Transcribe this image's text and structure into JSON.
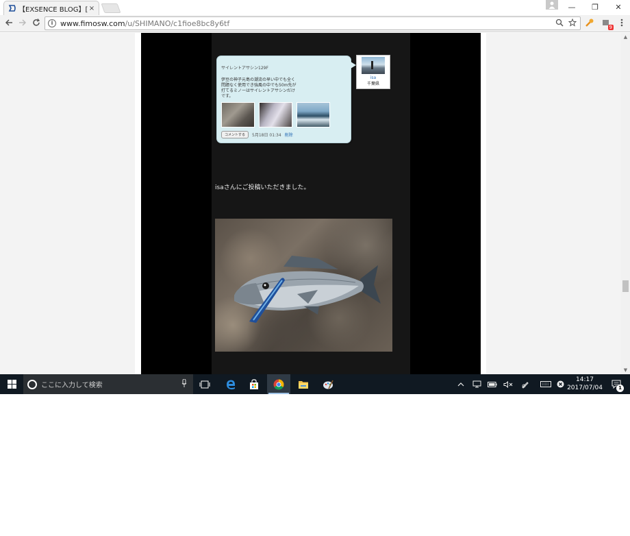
{
  "browser": {
    "tab_title": "【EXSENCE BLOG】[結果",
    "tab_close": "×",
    "url_host": "www.fimosw.com",
    "url_path": "/u/SHIMANO/c1fioe8bc8y6tf",
    "info_glyph": "i",
    "ext_badge": "9",
    "window_minimize": "—",
    "window_restore": "❐",
    "window_close": "✕"
  },
  "post": {
    "bubble_title": "サイレントアサシン129F",
    "bubble_body": "伊豆の神子元島の潮流の早い中でも全く問題なく使用でき強風の中でも50m先が打てるミノーはサイレントアサシンだけです。",
    "comment_button": "コメントする",
    "date": "5月18日 01:34",
    "delete_link": "削除",
    "user_name": "isa",
    "user_prefecture": "千葉県",
    "caption": "isaさんにご投稿いただきました。"
  },
  "taskbar": {
    "search_placeholder": "ここに入力して検索",
    "time": "14:17",
    "date": "2017/07/04",
    "notification_count": "1"
  },
  "colors": {
    "page_background": "#000000",
    "content_column": "#161616",
    "bubble_fill": "#d8eef2",
    "taskbar": "#101922",
    "link_blue": "#2a6db5"
  }
}
